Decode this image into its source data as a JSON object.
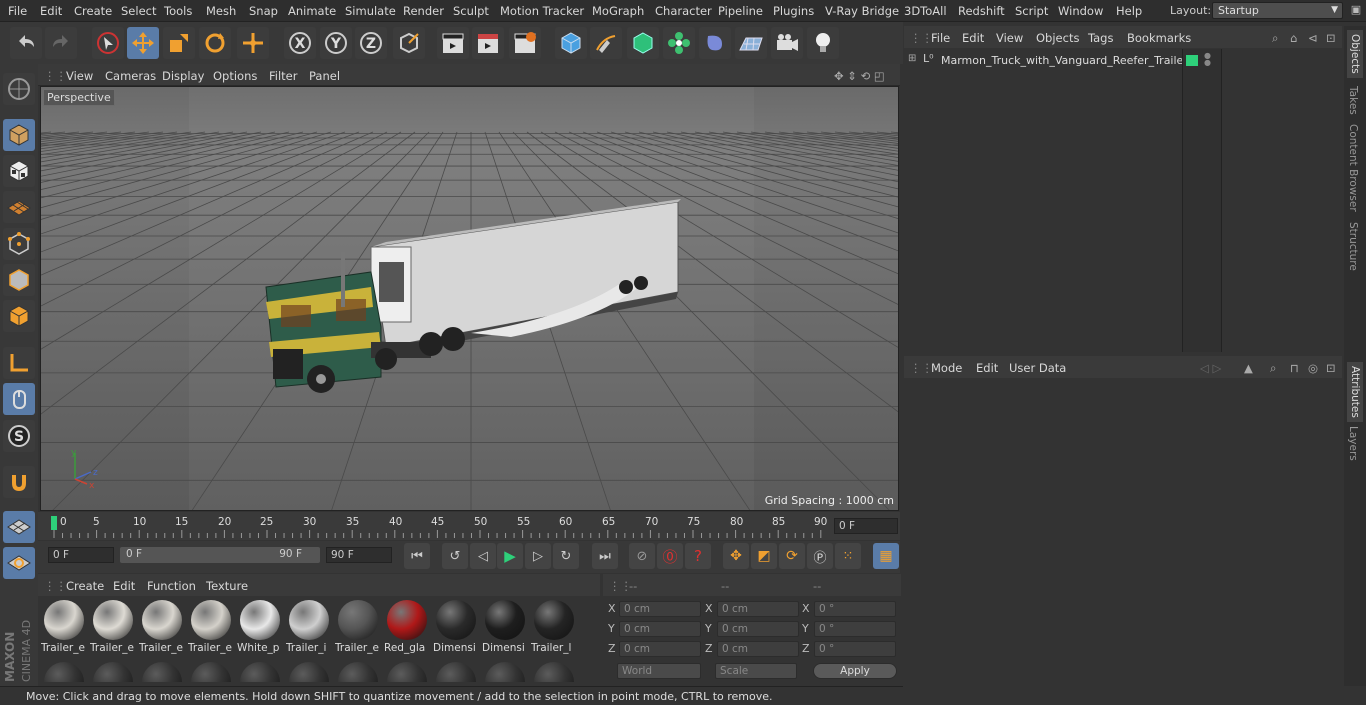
{
  "menubar": {
    "items": [
      "File",
      "Edit",
      "Create",
      "Select",
      "Tools",
      "Mesh",
      "Snap",
      "Animate",
      "Simulate",
      "Render",
      "Sculpt",
      "Motion Tracker",
      "MoGraph",
      "Character",
      "Pipeline",
      "Plugins",
      "V-Ray Bridge",
      "3DToAll",
      "Redshift",
      "Script",
      "Window",
      "Help"
    ],
    "layout_label": "Layout:",
    "layout_value": "Startup"
  },
  "viewport": {
    "menu": [
      "View",
      "Cameras",
      "Display",
      "Options",
      "Filter",
      "Panel"
    ],
    "label": "Perspective",
    "grid_spacing": "Grid Spacing : 1000 cm"
  },
  "timeline": {
    "ticks": [
      "0",
      "5",
      "10",
      "15",
      "20",
      "25",
      "30",
      "35",
      "40",
      "45",
      "50",
      "55",
      "60",
      "65",
      "70",
      "75",
      "80",
      "85",
      "90"
    ],
    "current_frame": "0 F",
    "start_field": "0 F",
    "range_start": "0 F",
    "range_end": "90 F",
    "end_field": "90 F"
  },
  "materials": {
    "menu": [
      "Create",
      "Edit",
      "Function",
      "Texture"
    ],
    "items": [
      {
        "label": "Trailer_e",
        "color": "#d9d6cf"
      },
      {
        "label": "Trailer_e",
        "color": "#dedbd4"
      },
      {
        "label": "Trailer_e",
        "color": "#d9d6cf"
      },
      {
        "label": "Trailer_e",
        "color": "#d4d1ca"
      },
      {
        "label": "White_p",
        "color": "#e8e8e8"
      },
      {
        "label": "Trailer_i",
        "color": "#cfcfcf"
      },
      {
        "label": "Trailer_e",
        "color": "#555555"
      },
      {
        "label": "Red_gla",
        "color": "#b01818"
      },
      {
        "label": "Dimensi",
        "color": "#2a2a2a"
      },
      {
        "label": "Dimensi",
        "color": "#1e1e1e"
      },
      {
        "label": "Trailer_l",
        "color": "#242424"
      }
    ]
  },
  "coords": {
    "headers": [
      "--",
      "--",
      "--"
    ],
    "rows": [
      {
        "a": "X",
        "pos": "0 cm",
        "b": "X",
        "size": "0 cm",
        "c": "X",
        "rot": "0 °"
      },
      {
        "a": "Y",
        "pos": "0 cm",
        "b": "Y",
        "size": "0 cm",
        "c": "Y",
        "rot": "0 °"
      },
      {
        "a": "Z",
        "pos": "0 cm",
        "b": "Z",
        "size": "0 cm",
        "c": "Z",
        "rot": "0 °"
      }
    ],
    "mode": "World",
    "scale": "Scale",
    "apply": "Apply"
  },
  "objects": {
    "menu": [
      "File",
      "Edit",
      "View",
      "Objects",
      "Tags",
      "Bookmarks"
    ],
    "tree": [
      {
        "name": "Marmon_Truck_with_Vanguard_Reefer_Trailer"
      }
    ]
  },
  "attributes": {
    "menu": [
      "Mode",
      "Edit",
      "User Data"
    ]
  },
  "sidetabs": [
    "Objects",
    "Takes",
    "Content Browser",
    "Structure",
    "Attributes",
    "Layers"
  ],
  "status": "Move: Click and drag to move elements. Hold down SHIFT to quantize movement / add to the selection in point mode, CTRL to remove.",
  "logo": {
    "line1": "MAXON",
    "line2": "CINEMA 4D"
  },
  "colors": {
    "accent": "#5a7ca8",
    "viewport_bg": "#5e5e5e",
    "truck_green": "#2e5c4a",
    "truck_yellow": "#c9b23a"
  }
}
